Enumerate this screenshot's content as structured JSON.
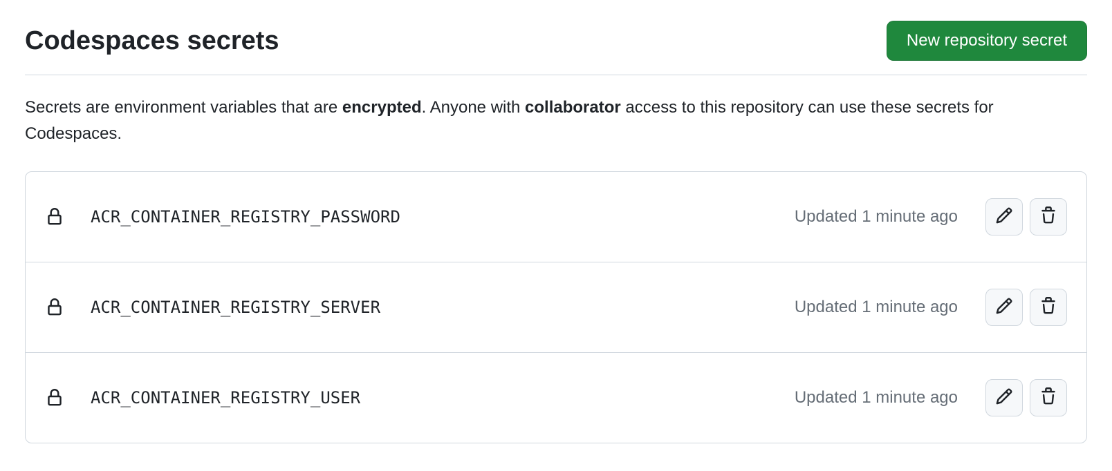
{
  "header": {
    "title": "Codespaces secrets",
    "new_button": "New repository secret"
  },
  "description": {
    "prefix": "Secrets are environment variables that are ",
    "bold1": "encrypted",
    "mid": ". Anyone with ",
    "bold2": "collaborator",
    "suffix": " access to this repository can use these secrets for Codespaces."
  },
  "updated_label_prefix": "Updated ",
  "secrets": [
    {
      "name": "ACR_CONTAINER_REGISTRY_PASSWORD",
      "updated": "1 minute ago"
    },
    {
      "name": "ACR_CONTAINER_REGISTRY_SERVER",
      "updated": "1 minute ago"
    },
    {
      "name": "ACR_CONTAINER_REGISTRY_USER",
      "updated": "1 minute ago"
    }
  ]
}
